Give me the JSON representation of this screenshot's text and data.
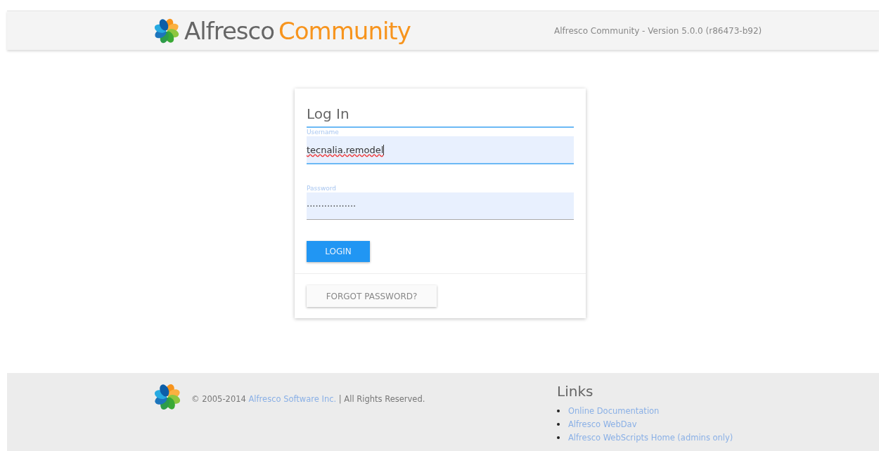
{
  "header": {
    "logo": {
      "brand": "Alfresco",
      "product": "Community"
    },
    "version": "Alfresco Community - Version 5.0.0 (r86473-b92)"
  },
  "login": {
    "title": "Log In",
    "fields": [
      {
        "label": "Username",
        "value": "tecnalia.remodel",
        "focused": true
      },
      {
        "label": "Password",
        "value": "·················",
        "focused": false
      }
    ],
    "submit": "LOGIN",
    "forgot": "FORGOT PASSWORD?"
  },
  "footer": {
    "copyright_prefix": "© 2005-2014",
    "company_link": "Alfresco Software Inc.",
    "copyright_suffix": "| All Rights Reserved.",
    "links_title": "Links",
    "links": [
      "Online Documentation",
      "Alfresco WebDav",
      "Alfresco WebScripts Home (admins only)"
    ]
  }
}
